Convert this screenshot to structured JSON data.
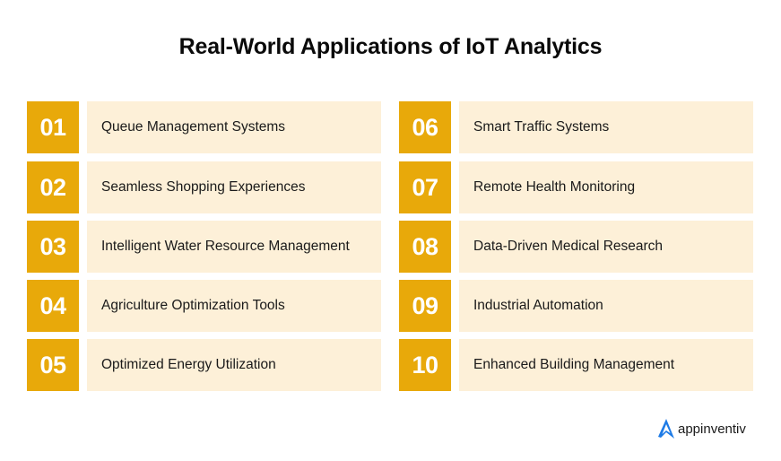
{
  "title": "Real-World Applications of IoT Analytics",
  "colors": {
    "number_box": "#e8a90a",
    "label_box": "#fdf0d8",
    "logo_accent": "#1e7be6"
  },
  "items": [
    {
      "number": "01",
      "label": "Queue Management Systems"
    },
    {
      "number": "02",
      "label": "Seamless Shopping Experiences"
    },
    {
      "number": "03",
      "label": "Intelligent Water Resource Management"
    },
    {
      "number": "04",
      "label": "Agriculture Optimization Tools"
    },
    {
      "number": "05",
      "label": "Optimized Energy Utilization"
    },
    {
      "number": "06",
      "label": "Smart Traffic Systems"
    },
    {
      "number": "07",
      "label": "Remote Health Monitoring"
    },
    {
      "number": "08",
      "label": "Data-Driven Medical Research"
    },
    {
      "number": "09",
      "label": "Industrial Automation"
    },
    {
      "number": "10",
      "label": "Enhanced Building Management"
    }
  ],
  "brand": {
    "name": "appinventiv",
    "icon": "appinventiv-logo-icon"
  }
}
